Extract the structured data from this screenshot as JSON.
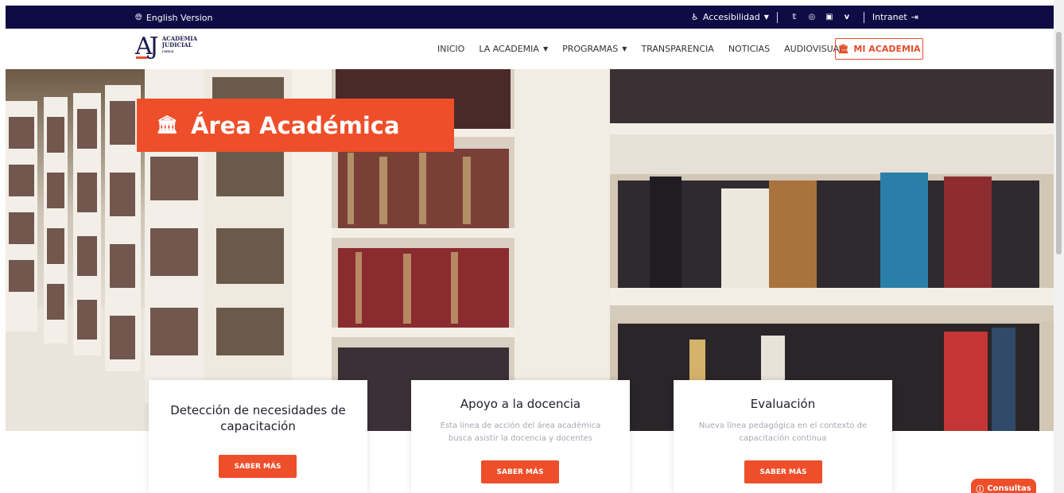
{
  "topbar": {
    "language_link": "English Version",
    "accessibility": "Accesibilidad",
    "social": [
      "twitter-icon",
      "instagram-icon",
      "linkedin-icon",
      "vimeo-icon"
    ],
    "intranet": "Intranet"
  },
  "logo": {
    "mark": "AJ",
    "line1": "ACADEMIA",
    "line2": "JUDICIAL",
    "line3": "CHILE"
  },
  "nav": {
    "items": [
      "INICIO",
      "LA ACADEMIA",
      "PROGRAMAS",
      "TRANSPARENCIA",
      "NOTICIAS",
      "AUDIOVISUAL"
    ],
    "cta": "MI ACADEMIA"
  },
  "hero": {
    "title": "Área Académica"
  },
  "cards": [
    {
      "title": "Detección de necesidades de capacitación",
      "description": "",
      "button": "SABER MÁS"
    },
    {
      "title": "Apoyo a la docencia",
      "description": "Esta línea de acción del área académica busca asistir la docencia y docentes",
      "button": "SABER MÁS"
    },
    {
      "title": "Evaluación",
      "description": "Nueva línea pedagógica en el contexto de capacitación continua",
      "button": "SABER MÁS"
    }
  ],
  "widget": {
    "consultas": "Consultas"
  },
  "colors": {
    "topbar": "#100a45",
    "accent": "#ee4e2a",
    "brand_text": "#1c1a4d"
  }
}
